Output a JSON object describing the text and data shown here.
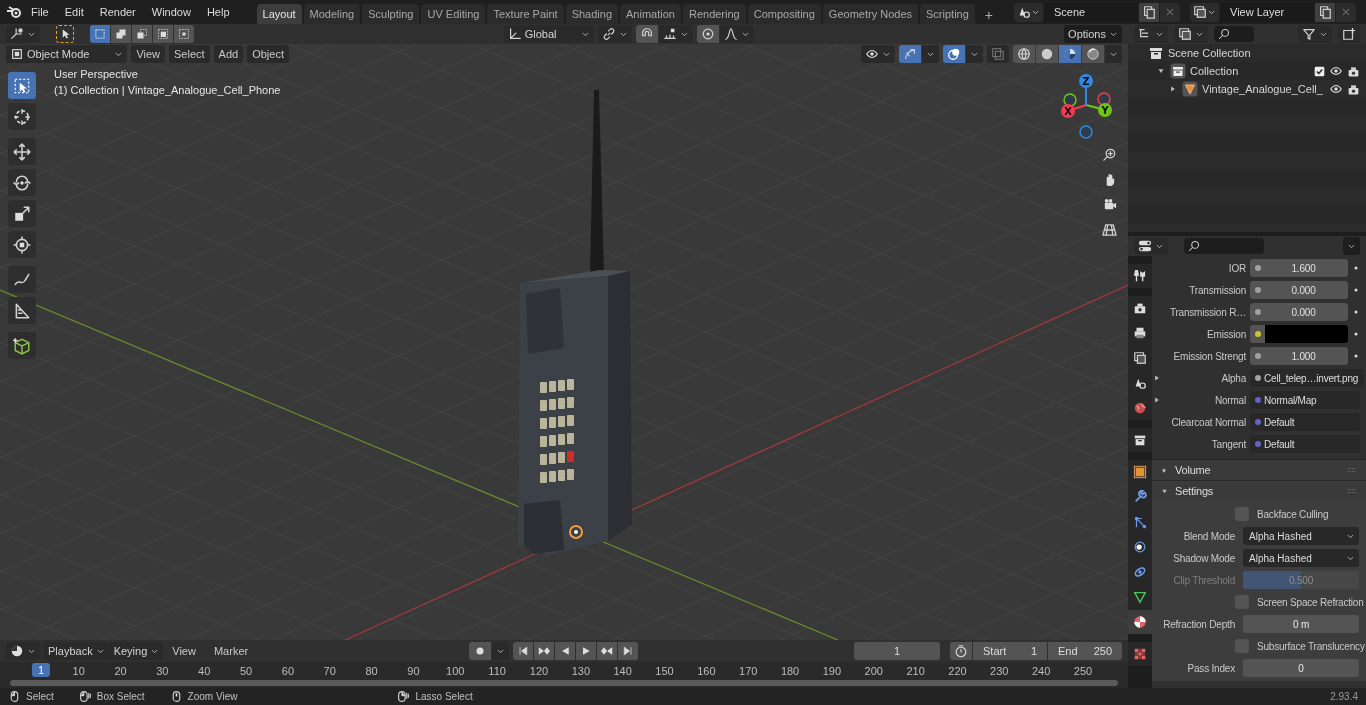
{
  "top_bar": {
    "menu": [
      "File",
      "Edit",
      "Render",
      "Window",
      "Help"
    ],
    "workspaces": [
      {
        "label": "Layout",
        "selected": true
      },
      {
        "label": "Modeling",
        "selected": false
      },
      {
        "label": "Sculpting",
        "selected": false
      },
      {
        "label": "UV Editing",
        "selected": false
      },
      {
        "label": "Texture Paint",
        "selected": false
      },
      {
        "label": "Shading",
        "selected": false
      },
      {
        "label": "Animation",
        "selected": false
      },
      {
        "label": "Rendering",
        "selected": false
      },
      {
        "label": "Compositing",
        "selected": false
      },
      {
        "label": "Geometry Nodes",
        "selected": false
      },
      {
        "label": "Scripting",
        "selected": false
      }
    ],
    "add_workspace": "+",
    "scene": "Scene",
    "view_layer": "View Layer"
  },
  "tool_header": {
    "select_modes": [
      {
        "kind": "new",
        "selected": true
      },
      {
        "kind": "extend",
        "selected": false
      },
      {
        "kind": "subtract",
        "selected": false
      },
      {
        "kind": "invert",
        "selected": false
      },
      {
        "kind": "intersect",
        "selected": false
      }
    ],
    "orientation": "Global",
    "snap": {
      "on": false
    },
    "options": "Options"
  },
  "viewport_header": {
    "mode": "Object Mode",
    "menus": [
      "View",
      "Select",
      "Add",
      "Object"
    ],
    "toggles": [
      {
        "kind": "gizmos",
        "on": true
      },
      {
        "kind": "overlays",
        "on": true
      },
      {
        "kind": "xray",
        "on": false
      }
    ],
    "shading": [
      {
        "kind": "wireframe",
        "selected": false
      },
      {
        "kind": "solid",
        "selected": false
      },
      {
        "kind": "material",
        "selected": true
      },
      {
        "kind": "rendered",
        "selected": false
      }
    ]
  },
  "toolbar": [
    {
      "tools": [
        {
          "kind": "select",
          "selected": true
        },
        {
          "kind": "cursor",
          "selected": false
        }
      ]
    },
    {
      "tools": [
        {
          "kind": "move",
          "selected": false
        },
        {
          "kind": "rotate",
          "selected": false
        },
        {
          "kind": "scale",
          "selected": false
        },
        {
          "kind": "transform",
          "selected": false
        }
      ]
    },
    {
      "tools": [
        {
          "kind": "annotate",
          "selected": false
        },
        {
          "kind": "measure",
          "selected": false
        }
      ]
    },
    {
      "tools": [
        {
          "kind": "add_cube",
          "selected": false
        }
      ]
    }
  ],
  "viewport": {
    "view_name": "User Perspective",
    "object_info": "(1) Collection | Vintage_Analogue_Cell_Phone",
    "axes": [
      {
        "label": "X",
        "color": "#f53a52"
      },
      {
        "label": "Y",
        "color": "#6ec419"
      },
      {
        "label": "Z",
        "color": "#2e8ae6"
      }
    ],
    "nav_buttons": [
      {
        "kind": "zoom"
      },
      {
        "kind": "pan"
      },
      {
        "kind": "camera"
      },
      {
        "kind": "perspective"
      }
    ]
  },
  "outliner": {
    "tree": [
      {
        "kind": "scene_collection",
        "label": "Scene Collection",
        "children": [
          {
            "kind": "collection",
            "label": "Collection",
            "expanded": true,
            "checked": true,
            "children": [
              {
                "kind": "mesh_object",
                "label": "Vintage_Analogue_Cell_",
                "expanded": false
              }
            ]
          }
        ]
      }
    ]
  },
  "properties": {
    "tabs": [
      {
        "tabs": [
          {
            "kind": "tool",
            "selected": false
          }
        ]
      },
      {
        "tabs": [
          {
            "kind": "render",
            "selected": false
          },
          {
            "kind": "output",
            "selected": false
          },
          {
            "kind": "view_layer",
            "selected": false
          },
          {
            "kind": "scene",
            "selected": false
          },
          {
            "kind": "world",
            "selected": false
          }
        ]
      },
      {
        "tabs": [
          {
            "kind": "collection",
            "selected": false
          }
        ]
      },
      {
        "tabs": [
          {
            "kind": "object",
            "selected": false
          },
          {
            "kind": "modifiers",
            "selected": false
          },
          {
            "kind": "particles",
            "selected": false
          },
          {
            "kind": "physics",
            "selected": false
          },
          {
            "kind": "constraints",
            "selected": false
          },
          {
            "kind": "data",
            "selected": false
          },
          {
            "kind": "material",
            "selected": true
          }
        ]
      },
      {
        "tabs": [
          {
            "kind": "texture",
            "selected": false
          }
        ]
      }
    ],
    "inputs": [
      {
        "kind": "number",
        "label": "IOR",
        "value": "1.600",
        "color": "#a1a1a1"
      },
      {
        "kind": "number",
        "label": "Transmission",
        "value": "0.000",
        "color": "#a1a1a1"
      },
      {
        "kind": "number",
        "label": "Transmission R…",
        "value": "0.000",
        "color": "#a1a1a1"
      },
      {
        "kind": "color",
        "label": "Emission",
        "color": "#c7c729"
      },
      {
        "kind": "number",
        "label": "Emission Strengt",
        "value": "1.000",
        "color": "#a1a1a1"
      },
      {
        "kind": "link",
        "label": "Alpha",
        "value": "Cell_telep…invert.png",
        "color": "#a1a1a1"
      },
      {
        "kind": "link",
        "label": "Normal",
        "value": "Normal/Map",
        "color": "#6363c7"
      },
      {
        "kind": "text",
        "label": "Clearcoat Normal",
        "value": "Default",
        "color": "#6363c7"
      },
      {
        "kind": "text",
        "label": "Tangent",
        "value": "Default",
        "color": "#6363c7"
      }
    ],
    "panels": [
      {
        "title": "Volume",
        "expanded": false
      },
      {
        "title": "Settings",
        "expanded": true,
        "rows": [
          {
            "kind": "checkbox",
            "label": "Backface Culling",
            "checked": false,
            "disabled": false
          },
          {
            "kind": "dropdown",
            "label": "Blend Mode",
            "value": "Alpha Hashed",
            "disabled": false
          },
          {
            "kind": "dropdown",
            "label": "Shadow Mode",
            "value": "Alpha Hashed",
            "disabled": false
          },
          {
            "kind": "slider",
            "label": "Clip Threshold",
            "value": "0.500",
            "level": 0.5,
            "disabled": true
          },
          {
            "kind": "checkbox",
            "label": "Screen Space Refraction",
            "checked": false,
            "disabled": false
          },
          {
            "kind": "number",
            "label": "Refraction Depth",
            "value": "0 m",
            "disabled": false
          },
          {
            "kind": "checkbox",
            "label": "Subsurface Translucency",
            "checked": false,
            "disabled": false
          },
          {
            "kind": "number",
            "label": "Pass Index",
            "value": "0",
            "disabled": false
          }
        ]
      }
    ]
  },
  "timeline": {
    "menus": [
      {
        "kind": "dropdown",
        "label": "Playback"
      },
      {
        "kind": "dropdown",
        "label": "Keying"
      },
      {
        "kind": "menu",
        "label": "View"
      },
      {
        "kind": "menu",
        "label": "Marker"
      }
    ],
    "auto_keying": {
      "on": false
    },
    "current_frame": "1",
    "start": {
      "label": "Start",
      "value": "1"
    },
    "end": {
      "label": "End",
      "value": "250"
    },
    "ruler": {
      "current": "1",
      "ticks": [
        "10",
        "20",
        "30",
        "40",
        "50",
        "60",
        "70",
        "80",
        "90",
        "100",
        "110",
        "120",
        "130",
        "140",
        "150",
        "160",
        "170",
        "180",
        "190",
        "200",
        "210",
        "220",
        "230",
        "240",
        "250"
      ]
    }
  },
  "status_bar": {
    "hints": [
      {
        "kind": "click",
        "label": "Select"
      },
      {
        "kind": "drag",
        "label": "Box Select"
      },
      {
        "kind": "middle",
        "label": "Zoom View"
      },
      {
        "kind": "right_drag",
        "label": "Lasso Select"
      }
    ],
    "version": "2.93.4"
  }
}
